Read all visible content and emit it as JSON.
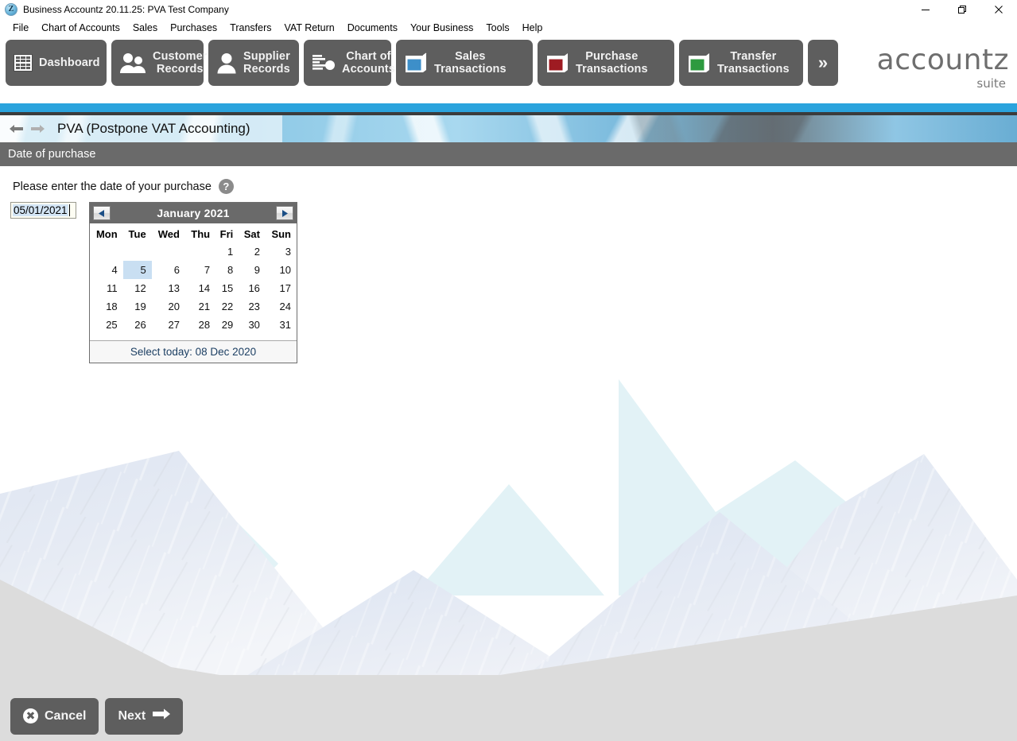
{
  "window": {
    "app_icon": "accountz-z-icon",
    "title": "Business Accountz 20.11.25: PVA Test Company",
    "controls": {
      "minimize": "minimize-icon",
      "restore": "restore-icon",
      "close": "close-icon"
    }
  },
  "menubar": {
    "items": [
      {
        "label": "File"
      },
      {
        "label": "Chart of Accounts"
      },
      {
        "label": "Sales"
      },
      {
        "label": "Purchases"
      },
      {
        "label": "Transfers"
      },
      {
        "label": "VAT Return"
      },
      {
        "label": "Documents"
      },
      {
        "label": "Your Business"
      },
      {
        "label": "Tools"
      },
      {
        "label": "Help"
      }
    ]
  },
  "toolbar": {
    "buttons": [
      {
        "label": "Dashboard",
        "icon": "grid-dashboard-icon"
      },
      {
        "label": "Customer\nRecords",
        "icon": "two-people-icon"
      },
      {
        "label": "Supplier\nRecords",
        "icon": "single-person-icon"
      },
      {
        "label": "Chart of\nAccounts",
        "icon": "bar-chart-pie-icon"
      },
      {
        "label": "Sales\nTransactions",
        "icon": "book-blue-icon"
      },
      {
        "label": "Purchase\nTransactions",
        "icon": "book-red-icon"
      },
      {
        "label": "Transfer\nTransactions",
        "icon": "book-green-icon"
      }
    ],
    "overflow_label": "»",
    "logo": {
      "name": "accountz",
      "sub": "suite"
    },
    "colors": {
      "button_bg": "#5e5e5e",
      "sales_accent": "#3d8fc9",
      "purchase_accent": "#9e1b22",
      "transfer_accent": "#2d9a3f"
    }
  },
  "page_header": {
    "back_icon": "arrow-left-icon",
    "forward_icon": "arrow-right-icon",
    "title": "PVA (Postpone VAT Accounting)",
    "accent_color": "#2aa3dd"
  },
  "section": {
    "title": "Date of purchase"
  },
  "form": {
    "prompt": "Please enter the date of your purchase",
    "help_icon": "question-mark-icon",
    "date_field": {
      "value": "05/01/2021",
      "selected": true
    }
  },
  "calendar": {
    "prev_label": "<",
    "next_label": ">",
    "month_title": "January 2021",
    "weekdays": [
      "Mon",
      "Tue",
      "Wed",
      "Thu",
      "Fri",
      "Sat",
      "Sun"
    ],
    "weeks": [
      [
        "",
        "",
        "",
        "",
        "1",
        "2",
        "3"
      ],
      [
        "4",
        "5",
        "6",
        "7",
        "8",
        "9",
        "10"
      ],
      [
        "11",
        "12",
        "13",
        "14",
        "15",
        "16",
        "17"
      ],
      [
        "18",
        "19",
        "20",
        "21",
        "22",
        "23",
        "24"
      ],
      [
        "25",
        "26",
        "27",
        "28",
        "29",
        "30",
        "31"
      ]
    ],
    "selected_day": "5",
    "selected_week_index": 1,
    "selected_col_index": 1,
    "today_label": "Select today: 08 Dec 2020",
    "selection_color": "#c9dff2"
  },
  "footer": {
    "cancel_label": "Cancel",
    "cancel_icon": "x-circle-icon",
    "next_label": "Next",
    "next_icon": "arrow-right-icon"
  }
}
